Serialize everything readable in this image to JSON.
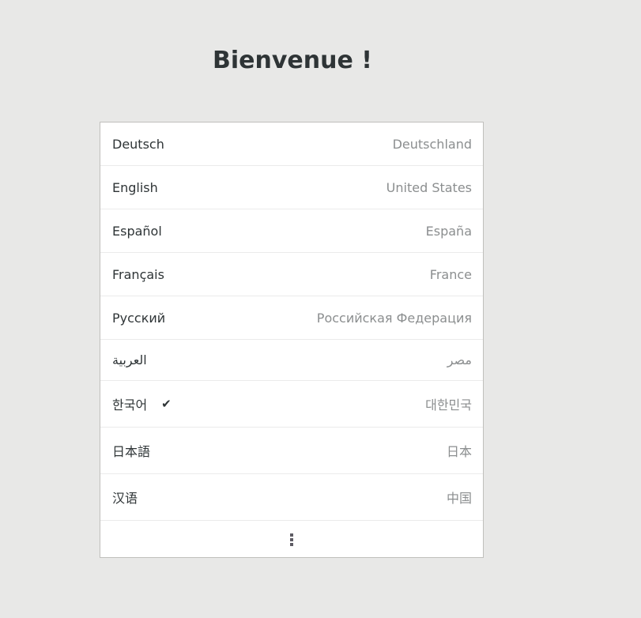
{
  "welcome_title": "Bienvenue !",
  "languages": [
    {
      "language": "Deutsch",
      "region": "Deutschland"
    },
    {
      "language": "English",
      "region": "United States"
    },
    {
      "language": "Español",
      "region": "España"
    },
    {
      "language": "Français",
      "region": "France"
    },
    {
      "language": "Русский",
      "region": "Российская Федерация"
    },
    {
      "language": "العربية",
      "region": "مصر"
    },
    {
      "language": "한국어",
      "region": "대한민국",
      "selected": true
    },
    {
      "language": "日本語",
      "region": "日本"
    },
    {
      "language": "汉语",
      "region": "中国"
    }
  ],
  "selected_check_icon": "check-icon",
  "more_icon": "more-vertical-icon"
}
